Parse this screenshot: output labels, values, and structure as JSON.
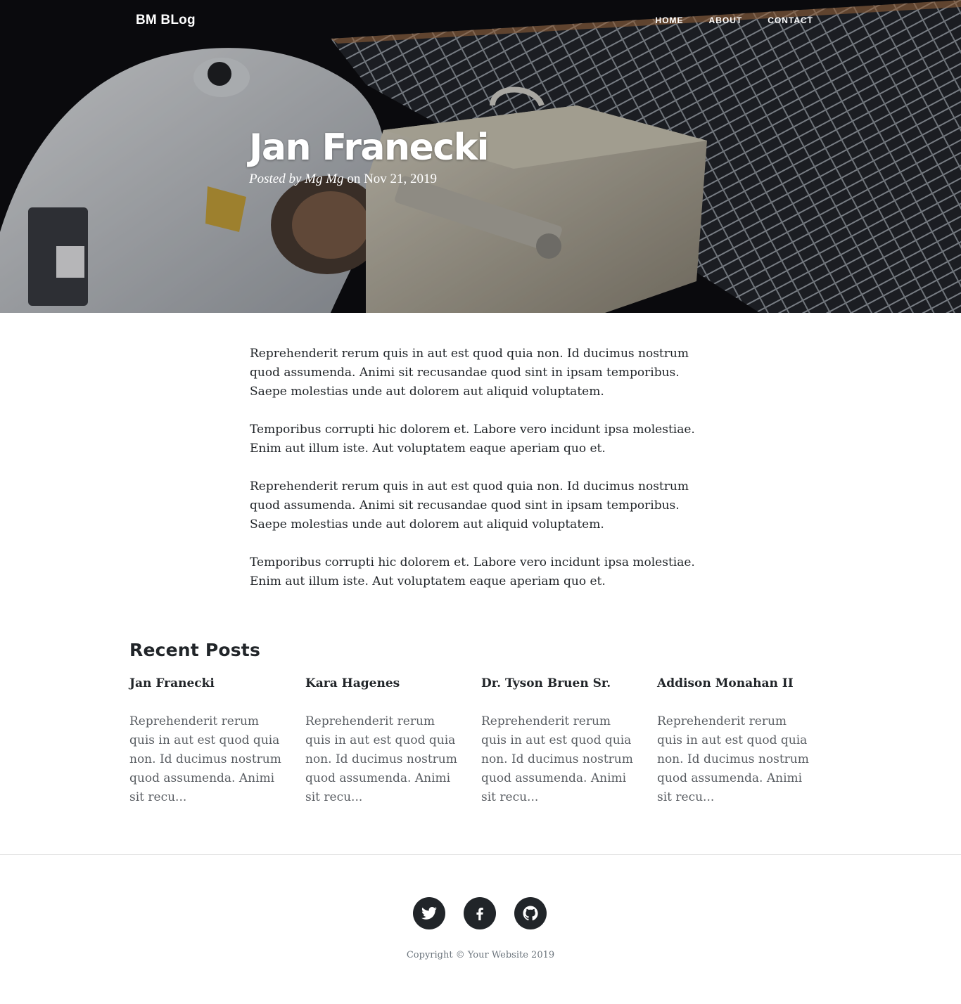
{
  "nav": {
    "brand": "BM BLog",
    "links": [
      "HOME",
      "ABOUT",
      "CONTACT"
    ]
  },
  "hero": {
    "title": "Jan Franecki",
    "meta_prefix": "Posted by",
    "author": "Mg Mg",
    "meta_on": "on",
    "date": "Nov 21, 2019",
    "image_icon": "astronaut-space-station-photo"
  },
  "article": {
    "paragraphs": [
      "Reprehenderit rerum quis in aut est quod quia non. Id ducimus nostrum quod assumenda. Animi sit recusandae quod sint in ipsam temporibus. Saepe molestias unde aut dolorem aut aliquid voluptatem.",
      "Temporibus corrupti hic dolorem et. Labore vero incidunt ipsa molestiae. Enim aut illum iste. Aut voluptatem eaque aperiam quo et.",
      "Reprehenderit rerum quis in aut est quod quia non. Id ducimus nostrum quod assumenda. Animi sit recusandae quod sint in ipsam temporibus. Saepe molestias unde aut dolorem aut aliquid voluptatem.",
      "Temporibus corrupti hic dolorem et. Labore vero incidunt ipsa molestiae. Enim aut illum iste. Aut voluptatem eaque aperiam quo et."
    ]
  },
  "recent": {
    "title": "Recent Posts",
    "posts": [
      {
        "title": "Jan Franecki",
        "excerpt": "Reprehenderit rerum quis in aut est quod quia non. Id ducimus nostrum quod assumenda. Animi sit recu..."
      },
      {
        "title": "Kara Hagenes",
        "excerpt": "Reprehenderit rerum quis in aut est quod quia non. Id ducimus nostrum quod assumenda. Animi sit recu..."
      },
      {
        "title": "Dr. Tyson Bruen Sr.",
        "excerpt": "Reprehenderit rerum quis in aut est quod quia non. Id ducimus nostrum quod assumenda. Animi sit recu..."
      },
      {
        "title": "Addison Monahan II",
        "excerpt": "Reprehenderit rerum quis in aut est quod quia non. Id ducimus nostrum quod assumenda. Animi sit recu..."
      }
    ]
  },
  "footer": {
    "social": [
      "twitter-icon",
      "facebook-icon",
      "github-icon"
    ],
    "copyright": "Copyright © Your Website 2019"
  },
  "colors": {
    "text": "#212529",
    "muted": "#6c757d",
    "social_bg": "#212529"
  }
}
